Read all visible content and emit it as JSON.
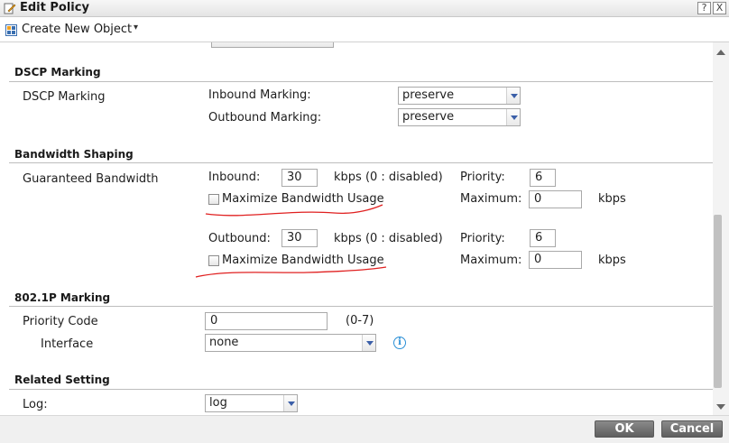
{
  "window": {
    "title": "Edit Policy",
    "help_label": "?",
    "close_label": "X"
  },
  "toolbar": {
    "create_label": "Create New Object",
    "caret": "▾"
  },
  "dscp": {
    "section_title": "DSCP Marking",
    "label": "DSCP Marking",
    "inbound_label": "Inbound Marking:",
    "inbound_value": "preserve",
    "outbound_label": "Outbound Marking:",
    "outbound_value": "preserve"
  },
  "bandwidth": {
    "section_title": "Bandwidth Shaping",
    "label": "Guaranteed Bandwidth",
    "inbound": {
      "label": "Inbound:",
      "value": "30",
      "unit": "kbps (0 : disabled)",
      "priority_label": "Priority:",
      "priority_value": "6",
      "maximize_label": "Maximize Bandwidth Usage",
      "maximum_label": "Maximum:",
      "maximum_value": "0",
      "maximum_unit": "kbps"
    },
    "outbound": {
      "label": "Outbound:",
      "value": "30",
      "unit": "kbps (0 : disabled)",
      "priority_label": "Priority:",
      "priority_value": "6",
      "maximize_label": "Maximize Bandwidth Usage",
      "maximum_label": "Maximum:",
      "maximum_value": "0",
      "maximum_unit": "kbps"
    }
  },
  "p8021": {
    "section_title": "802.1P Marking",
    "priority_label": "Priority Code",
    "priority_value": "0",
    "priority_range": "(0-7)",
    "interface_label": "Interface",
    "interface_value": "none"
  },
  "related": {
    "section_title": "Related Setting",
    "log_label": "Log:",
    "log_value": "log"
  },
  "footer": {
    "ok_label": "OK",
    "cancel_label": "Cancel"
  },
  "colors": {
    "annotation": "#e02020",
    "info": "#2a8fd6",
    "button": "#6f6f6f"
  }
}
